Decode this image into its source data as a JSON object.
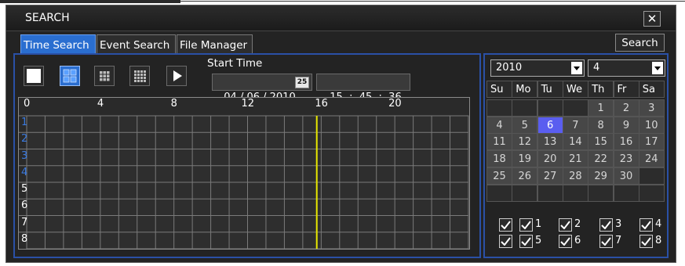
{
  "window": {
    "title": "SEARCH",
    "close_label": "✕"
  },
  "tabs": [
    {
      "label": "Time Search",
      "active": true
    },
    {
      "label": "Event Search",
      "active": false
    },
    {
      "label": "File Manager",
      "active": false
    }
  ],
  "search_button": "Search",
  "layout_buttons": [
    "single-view-icon",
    "quad-view-icon",
    "nine-view-icon",
    "sixteen-view-icon",
    "play-icon"
  ],
  "start_time": {
    "label": "Start Time",
    "date": "04 / 06 / 2010",
    "time": "15  :  45  :  36",
    "calendar_icon_text": "25"
  },
  "timeline": {
    "hour_labels": [
      "0",
      "4",
      "8",
      "12",
      "16",
      "20"
    ],
    "channels": [
      "1",
      "2",
      "3",
      "4",
      "5",
      "6",
      "7",
      "8"
    ],
    "marker_hour": 15.76,
    "marker_color": "#e8e800",
    "active_channel_color": "#3a7ae0"
  },
  "calendar": {
    "year": "2010",
    "month": "4",
    "weekdays": [
      "Su",
      "Mo",
      "Tu",
      "We",
      "Th",
      "Fr",
      "Sa"
    ],
    "weeks": [
      [
        "",
        "",
        "",
        "",
        "1",
        "2",
        "3"
      ],
      [
        "4",
        "5",
        "6",
        "7",
        "8",
        "9",
        "10"
      ],
      [
        "11",
        "12",
        "13",
        "14",
        "15",
        "16",
        "17"
      ],
      [
        "18",
        "19",
        "20",
        "21",
        "22",
        "23",
        "24"
      ],
      [
        "25",
        "26",
        "27",
        "28",
        "29",
        "30",
        ""
      ],
      [
        "",
        "",
        "",
        "",
        "",
        "",
        ""
      ]
    ],
    "selected_day": "6"
  },
  "channel_checks": {
    "row1": [
      "",
      "1",
      "2",
      "3",
      "4"
    ],
    "row2": [
      "",
      "5",
      "6",
      "7",
      "8"
    ]
  },
  "colors": {
    "accent": "#2a6ed0",
    "panel_border": "#2a50a6",
    "selected_day": "#5a5ef0"
  }
}
